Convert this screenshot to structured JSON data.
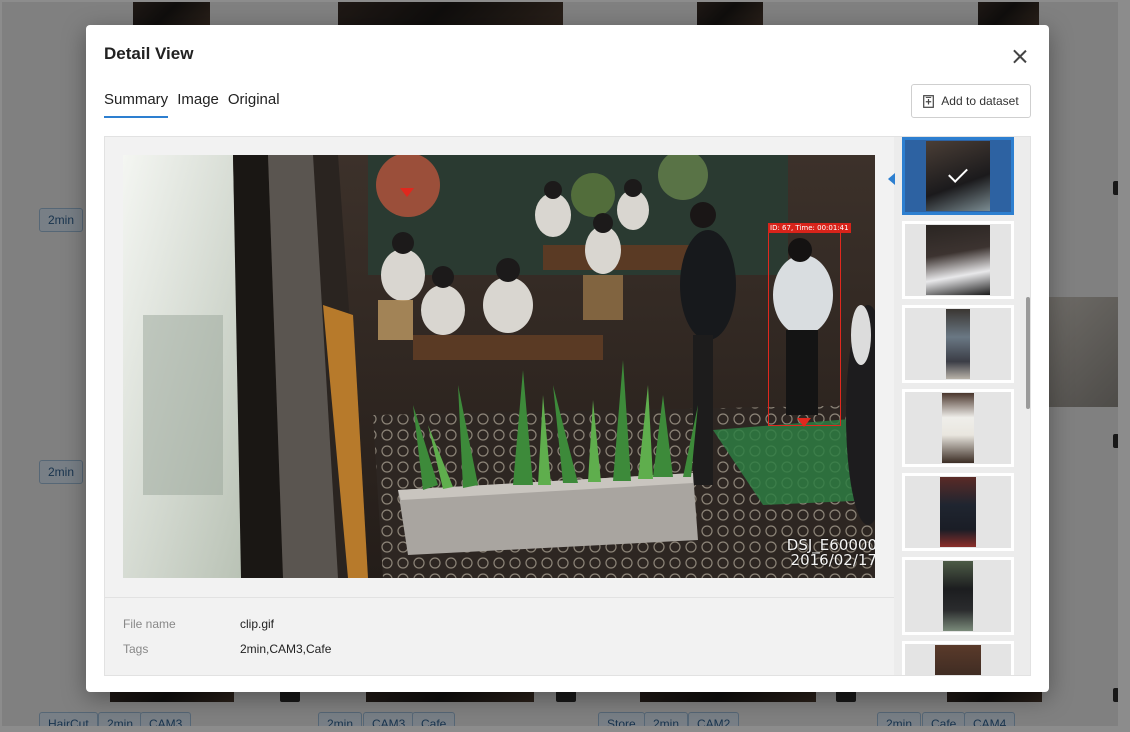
{
  "modal": {
    "title": "Detail View",
    "close_icon": "close-icon",
    "tabs": [
      {
        "label": "Summary",
        "active": true
      },
      {
        "label": "Image",
        "active": false
      },
      {
        "label": "Original",
        "active": false
      }
    ],
    "add_button_label": "Add to dataset",
    "add_button_icon": "add-to-dataset-icon"
  },
  "viewer": {
    "detection_label": "ID: 67, Time: 00:01:41",
    "watermark_line1": "DSJ_E60000",
    "watermark_line2": "2016/02/17",
    "detection_color": "#e0281e"
  },
  "metadata": {
    "file_name_label": "File name",
    "file_name": "clip.gif",
    "tags_label": "Tags",
    "tags": "2min,CAM3,Cafe"
  },
  "thumbnails": {
    "selected_index": 0,
    "accent": "#2d7fd0",
    "count_visible": 7
  },
  "background": {
    "chips_row1": [
      "2min"
    ],
    "chips_row2": [
      "2min"
    ],
    "chips_bottom": [
      [
        "HairCut",
        "2min",
        "CAM3"
      ],
      [
        "2min",
        "CAM3",
        "Cafe"
      ],
      [
        "Store",
        "2min",
        "CAM2"
      ],
      [
        "2min",
        "Cafe",
        "CAM4"
      ]
    ]
  }
}
